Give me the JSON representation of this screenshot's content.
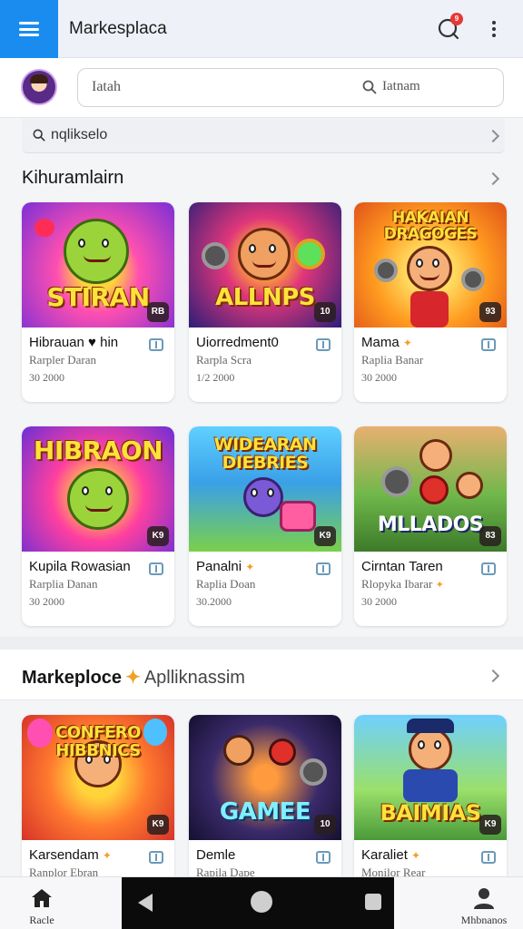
{
  "app": {
    "title": "Markesplaca",
    "notification_count": "9"
  },
  "search": {
    "placeholder": "Iatah",
    "right_label": "Iatnam"
  },
  "subbar": {
    "label": "nqlikselo"
  },
  "sections": [
    {
      "title": "Kihuramlairn",
      "cards": [
        {
          "art_text": "STIRAN",
          "name": "Hibrauan ♥ hin",
          "icon": "heart-icon",
          "developer": "Rarpler Daran",
          "count": "30 2000",
          "badge": "RB"
        },
        {
          "art_text": "ALLNPS",
          "name": "Uiorredment0",
          "icon": "",
          "developer": "Rarpla Scra",
          "count": "1/2 2000",
          "badge": "10"
        },
        {
          "art_text": "HAKAIAN DRAGOGES",
          "name": "Mama",
          "icon": "spark-icon",
          "developer": "Raplia Banar",
          "count": "30 2000",
          "badge": "93"
        },
        {
          "art_text": "HIBRAON",
          "name": "Kupila Rowasian",
          "icon": "",
          "developer": "Rarplia Danan",
          "count": "30 2000",
          "badge": "K9"
        },
        {
          "art_text": "WIDEARAN DIEBRIES",
          "name": "Panalni",
          "icon": "spark-icon",
          "developer": "Raplia Doan",
          "count": "30.2000",
          "badge": "K9"
        },
        {
          "art_text": "MLLADOS",
          "name": "Cirntan Taren",
          "icon": "",
          "developer": "Rlopyka Ibarar",
          "count": "30 2000",
          "badge": "83"
        }
      ]
    },
    {
      "title": "Markeploce",
      "subtitle": "Aplliknassim",
      "cards": [
        {
          "art_text": "CONFERO HIBBNICS",
          "name": "Karsendam",
          "icon": "spark-icon",
          "developer": "Ranplor Ebran",
          "count": "",
          "badge": "K9"
        },
        {
          "art_text": "GAMEE",
          "name": "Demle",
          "icon": "",
          "developer": "Rapila Dape",
          "count": "",
          "badge": "10"
        },
        {
          "art_text": "BAIMIAS",
          "name": "Karaliet",
          "icon": "spark-icon",
          "developer": "Monilor Rear",
          "count": "",
          "badge": "K9"
        }
      ]
    }
  ],
  "bottom_nav": {
    "home_label": "Racle",
    "profile_label": "Mhbnanos"
  },
  "colors": {
    "accent": "#1a8cf0",
    "badge": "#e53935",
    "spark": "#f2a024"
  }
}
